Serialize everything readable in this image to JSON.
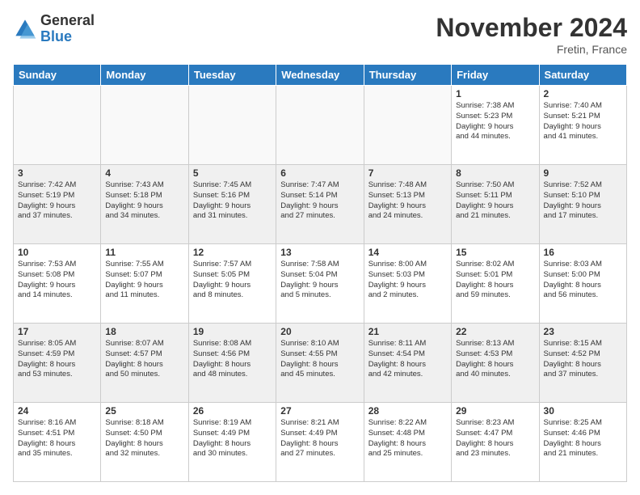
{
  "logo": {
    "general": "General",
    "blue": "Blue"
  },
  "header": {
    "month": "November 2024",
    "location": "Fretin, France"
  },
  "days_of_week": [
    "Sunday",
    "Monday",
    "Tuesday",
    "Wednesday",
    "Thursday",
    "Friday",
    "Saturday"
  ],
  "weeks": [
    [
      {
        "day": "",
        "info": ""
      },
      {
        "day": "",
        "info": ""
      },
      {
        "day": "",
        "info": ""
      },
      {
        "day": "",
        "info": ""
      },
      {
        "day": "",
        "info": ""
      },
      {
        "day": "1",
        "info": "Sunrise: 7:38 AM\nSunset: 5:23 PM\nDaylight: 9 hours\nand 44 minutes."
      },
      {
        "day": "2",
        "info": "Sunrise: 7:40 AM\nSunset: 5:21 PM\nDaylight: 9 hours\nand 41 minutes."
      }
    ],
    [
      {
        "day": "3",
        "info": "Sunrise: 7:42 AM\nSunset: 5:19 PM\nDaylight: 9 hours\nand 37 minutes."
      },
      {
        "day": "4",
        "info": "Sunrise: 7:43 AM\nSunset: 5:18 PM\nDaylight: 9 hours\nand 34 minutes."
      },
      {
        "day": "5",
        "info": "Sunrise: 7:45 AM\nSunset: 5:16 PM\nDaylight: 9 hours\nand 31 minutes."
      },
      {
        "day": "6",
        "info": "Sunrise: 7:47 AM\nSunset: 5:14 PM\nDaylight: 9 hours\nand 27 minutes."
      },
      {
        "day": "7",
        "info": "Sunrise: 7:48 AM\nSunset: 5:13 PM\nDaylight: 9 hours\nand 24 minutes."
      },
      {
        "day": "8",
        "info": "Sunrise: 7:50 AM\nSunset: 5:11 PM\nDaylight: 9 hours\nand 21 minutes."
      },
      {
        "day": "9",
        "info": "Sunrise: 7:52 AM\nSunset: 5:10 PM\nDaylight: 9 hours\nand 17 minutes."
      }
    ],
    [
      {
        "day": "10",
        "info": "Sunrise: 7:53 AM\nSunset: 5:08 PM\nDaylight: 9 hours\nand 14 minutes."
      },
      {
        "day": "11",
        "info": "Sunrise: 7:55 AM\nSunset: 5:07 PM\nDaylight: 9 hours\nand 11 minutes."
      },
      {
        "day": "12",
        "info": "Sunrise: 7:57 AM\nSunset: 5:05 PM\nDaylight: 9 hours\nand 8 minutes."
      },
      {
        "day": "13",
        "info": "Sunrise: 7:58 AM\nSunset: 5:04 PM\nDaylight: 9 hours\nand 5 minutes."
      },
      {
        "day": "14",
        "info": "Sunrise: 8:00 AM\nSunset: 5:03 PM\nDaylight: 9 hours\nand 2 minutes."
      },
      {
        "day": "15",
        "info": "Sunrise: 8:02 AM\nSunset: 5:01 PM\nDaylight: 8 hours\nand 59 minutes."
      },
      {
        "day": "16",
        "info": "Sunrise: 8:03 AM\nSunset: 5:00 PM\nDaylight: 8 hours\nand 56 minutes."
      }
    ],
    [
      {
        "day": "17",
        "info": "Sunrise: 8:05 AM\nSunset: 4:59 PM\nDaylight: 8 hours\nand 53 minutes."
      },
      {
        "day": "18",
        "info": "Sunrise: 8:07 AM\nSunset: 4:57 PM\nDaylight: 8 hours\nand 50 minutes."
      },
      {
        "day": "19",
        "info": "Sunrise: 8:08 AM\nSunset: 4:56 PM\nDaylight: 8 hours\nand 48 minutes."
      },
      {
        "day": "20",
        "info": "Sunrise: 8:10 AM\nSunset: 4:55 PM\nDaylight: 8 hours\nand 45 minutes."
      },
      {
        "day": "21",
        "info": "Sunrise: 8:11 AM\nSunset: 4:54 PM\nDaylight: 8 hours\nand 42 minutes."
      },
      {
        "day": "22",
        "info": "Sunrise: 8:13 AM\nSunset: 4:53 PM\nDaylight: 8 hours\nand 40 minutes."
      },
      {
        "day": "23",
        "info": "Sunrise: 8:15 AM\nSunset: 4:52 PM\nDaylight: 8 hours\nand 37 minutes."
      }
    ],
    [
      {
        "day": "24",
        "info": "Sunrise: 8:16 AM\nSunset: 4:51 PM\nDaylight: 8 hours\nand 35 minutes."
      },
      {
        "day": "25",
        "info": "Sunrise: 8:18 AM\nSunset: 4:50 PM\nDaylight: 8 hours\nand 32 minutes."
      },
      {
        "day": "26",
        "info": "Sunrise: 8:19 AM\nSunset: 4:49 PM\nDaylight: 8 hours\nand 30 minutes."
      },
      {
        "day": "27",
        "info": "Sunrise: 8:21 AM\nSunset: 4:49 PM\nDaylight: 8 hours\nand 27 minutes."
      },
      {
        "day": "28",
        "info": "Sunrise: 8:22 AM\nSunset: 4:48 PM\nDaylight: 8 hours\nand 25 minutes."
      },
      {
        "day": "29",
        "info": "Sunrise: 8:23 AM\nSunset: 4:47 PM\nDaylight: 8 hours\nand 23 minutes."
      },
      {
        "day": "30",
        "info": "Sunrise: 8:25 AM\nSunset: 4:46 PM\nDaylight: 8 hours\nand 21 minutes."
      }
    ]
  ]
}
